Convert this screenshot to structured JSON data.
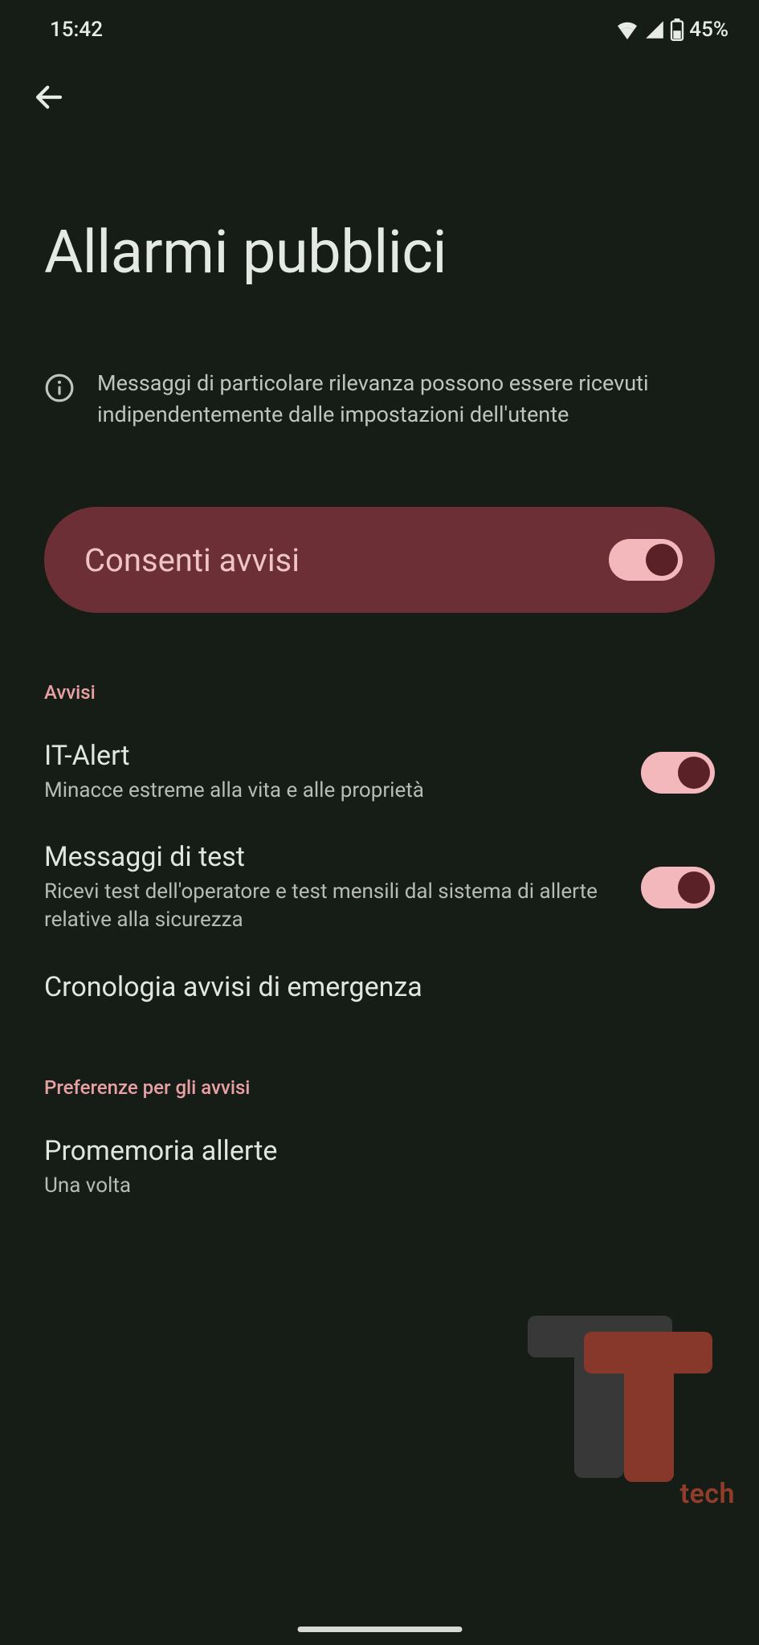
{
  "status_bar": {
    "time": "15:42",
    "battery_percent": "45%"
  },
  "page": {
    "title": "Allarmi pubblici",
    "info_text": "Messaggi di particolare rilevanza possono essere ricevuti indipendentemente dalle impostazioni dell'utente"
  },
  "primary_toggle": {
    "label": "Consenti avvisi",
    "on": true
  },
  "sections": {
    "avvisi": {
      "header": "Avvisi",
      "items": [
        {
          "title": "IT-Alert",
          "subtitle": "Minacce estreme alla vita e alle proprietà",
          "has_switch": true,
          "on": true
        },
        {
          "title": "Messaggi di test",
          "subtitle": "Ricevi test dell'operatore e test mensili dal sistema di allerte relative alla sicurezza",
          "has_switch": true,
          "on": true
        },
        {
          "title": "Cronologia avvisi di emergenza",
          "subtitle": "",
          "has_switch": false
        }
      ]
    },
    "preferenze": {
      "header": "Preferenze per gli avvisi",
      "items": [
        {
          "title": "Promemoria allerte",
          "subtitle": "Una volta",
          "has_switch": false
        }
      ]
    }
  },
  "watermark": {
    "text": "tech"
  },
  "colors": {
    "bg": "#161c16",
    "accent_pill": "#6b2f35",
    "accent_text": "#e8a0a4",
    "switch_track": "#f2b8bc",
    "switch_thumb": "#5a2227"
  }
}
